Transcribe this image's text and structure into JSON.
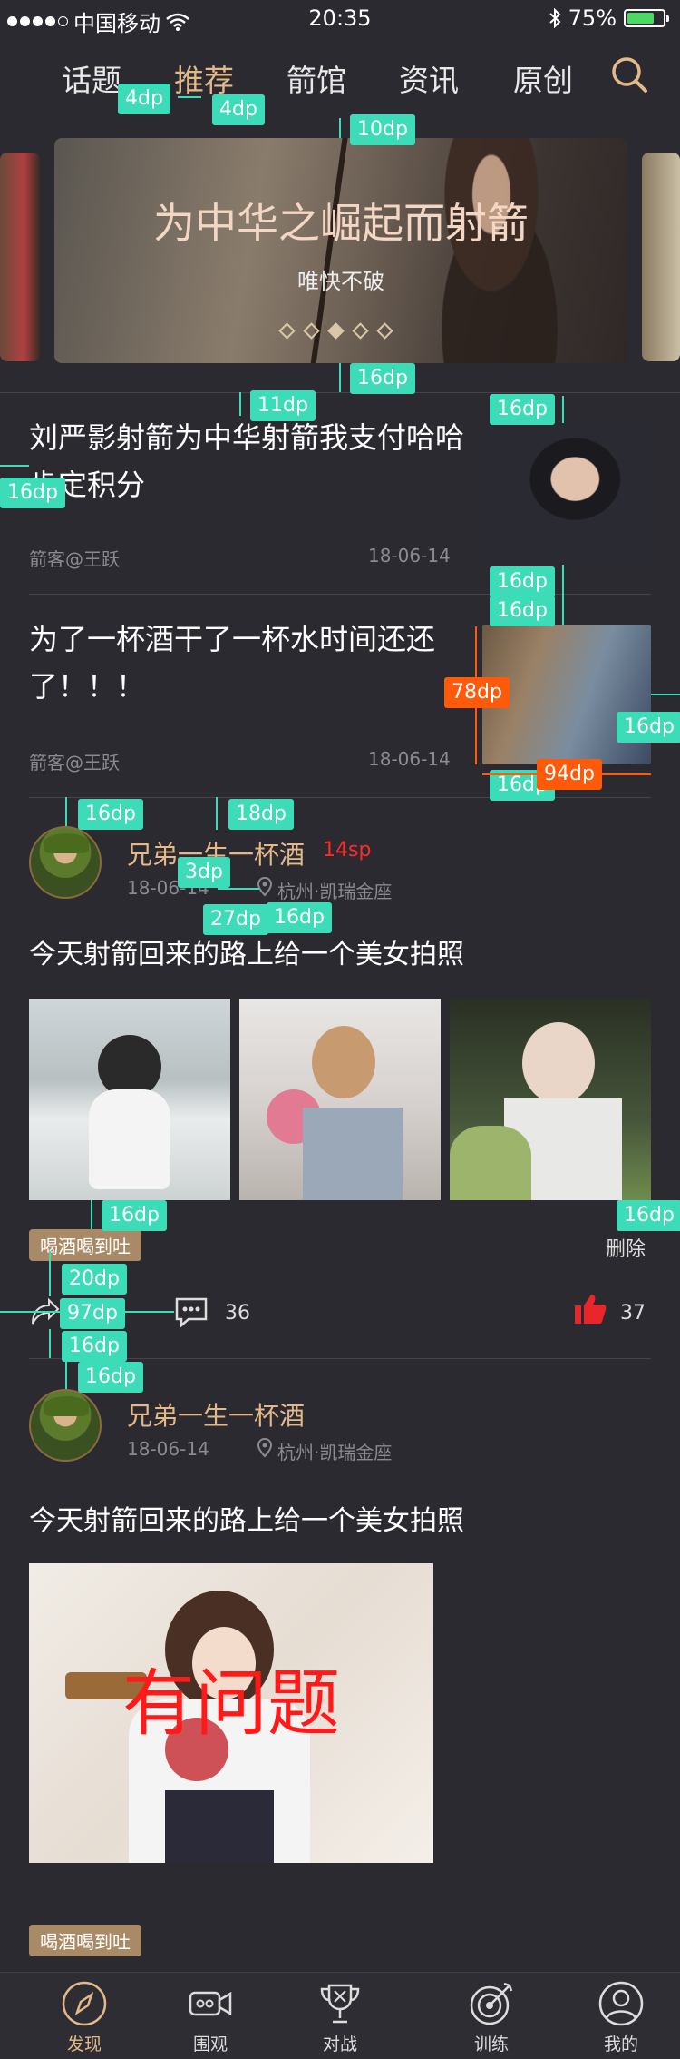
{
  "status_bar": {
    "carrier": "中国移动",
    "time": "20:35",
    "battery": "75%"
  },
  "tabs": [
    {
      "label": "话题"
    },
    {
      "label": "推荐"
    },
    {
      "label": "箭馆"
    },
    {
      "label": "资讯"
    },
    {
      "label": "原创"
    }
  ],
  "banner": {
    "title": "为中华之崛起而射箭",
    "subtitle": "唯快不破"
  },
  "articles": [
    {
      "title": "刘严影射箭为中华射箭我支付哈哈肯定积分",
      "author": "箭客@王跃",
      "date": "18-06-14"
    },
    {
      "title": "为了一杯酒干了一杯水时间还还了！！！",
      "author": "箭客@王跃",
      "date": "18-06-14"
    }
  ],
  "posts": [
    {
      "username": "兄弟一生一杯酒",
      "level": "14sp",
      "date": "18-06-14",
      "location": "杭州·凯瑞金座",
      "text": "今天射箭回来的路上给一个美女拍照",
      "tag": "喝酒喝到吐",
      "delete_label": "删除",
      "comment_count": "36",
      "like_count": "37"
    },
    {
      "username": "兄弟一生一杯酒",
      "date": "18-06-14",
      "location": "杭州·凯瑞金座",
      "text": "今天射箭回来的路上给一个美女拍照",
      "overlay_text": "有问题",
      "tag": "喝酒喝到吐"
    }
  ],
  "annotations": {
    "a1": "4dp",
    "a2": "4dp",
    "a3": "10dp",
    "a4": "16dp",
    "a5": "11dp",
    "a6": "16dp",
    "a7": "16dp",
    "a8": "16dp",
    "a9": "16dp",
    "a10": "78dp",
    "a11": "16dp",
    "a12": "16dp",
    "a13": "94dp",
    "a14": "16dp",
    "a15": "18dp",
    "a16": "3dp",
    "a17": "27dp",
    "a18": "16dp",
    "a19": "16dp",
    "a20": "16dp",
    "a21": "20dp",
    "a22": "97dp",
    "a23": "16dp",
    "a24": "16dp"
  },
  "bottom_nav": [
    {
      "label": "发现",
      "icon": "compass-icon"
    },
    {
      "label": "围观",
      "icon": "video-icon"
    },
    {
      "label": "对战",
      "icon": "trophy-icon"
    },
    {
      "label": "训练",
      "icon": "target-icon"
    },
    {
      "label": "我的",
      "icon": "user-icon"
    }
  ],
  "colors": {
    "background": "#2b2a30",
    "accent": "#e3b98a",
    "annotation": "#3ddcb8",
    "annotation_alt": "#ff5a0a",
    "like": "#e8262c"
  }
}
